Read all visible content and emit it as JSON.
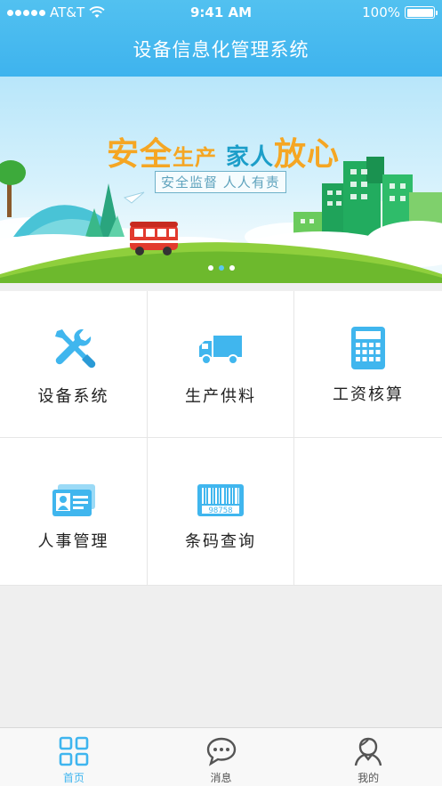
{
  "status_bar": {
    "carrier": "AT&T",
    "time": "9:41 AM",
    "battery": "100%"
  },
  "header": {
    "title": "设备信息化管理系统"
  },
  "banner": {
    "headline_part1": "安全",
    "headline_part2": "生产",
    "headline_part3": "家人",
    "headline_part4": "放心",
    "subline": "安全监督 人人有责",
    "page_count": 3,
    "active_page": 1
  },
  "menu": {
    "items": [
      {
        "label": "设备系统",
        "icon": "tools-icon"
      },
      {
        "label": "生产供料",
        "icon": "truck-icon"
      },
      {
        "label": "工资核算",
        "icon": "calculator-icon"
      },
      {
        "label": "人事管理",
        "icon": "id-card-icon"
      },
      {
        "label": "条码查询",
        "icon": "barcode-icon",
        "barcode_number": "98758"
      }
    ]
  },
  "tabbar": {
    "items": [
      {
        "label": "首页",
        "icon": "home-grid-icon",
        "active": true
      },
      {
        "label": "消息",
        "icon": "message-icon",
        "active": false
      },
      {
        "label": "我的",
        "icon": "user-icon",
        "active": false
      }
    ]
  },
  "colors": {
    "brand": "#3eb3ee",
    "icon": "#40b6ee",
    "accent_orange": "#f5a623"
  }
}
